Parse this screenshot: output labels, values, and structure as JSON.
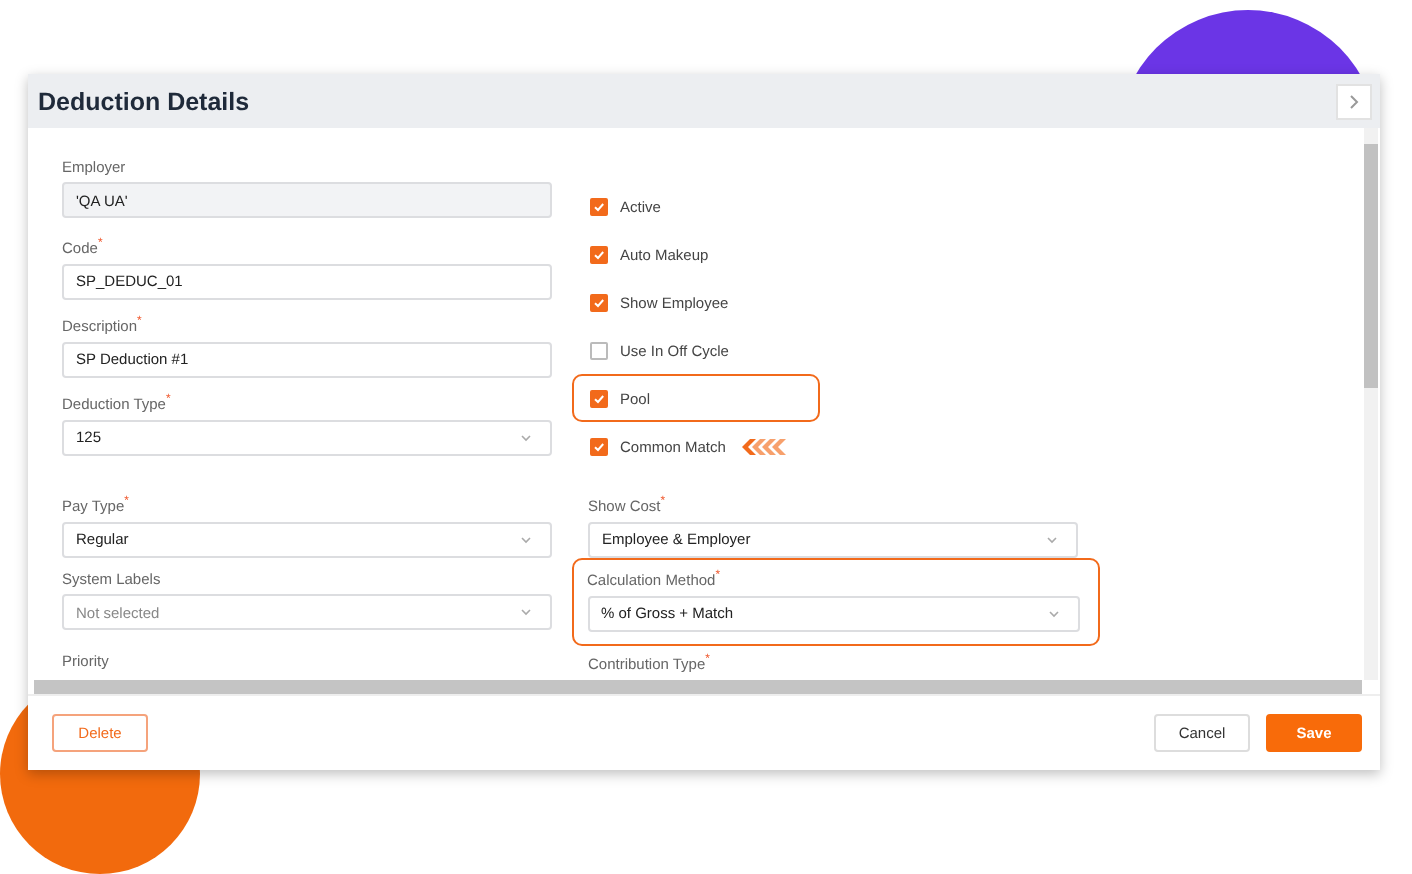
{
  "dialog": {
    "title": "Deduction Details"
  },
  "left_fields": [
    {
      "label": "Employer",
      "value": "'QA UA'",
      "kind": "text",
      "disabled": true
    },
    {
      "label": "Code$^{*}$",
      "value": "SP_DEDUC_01",
      "kind": "text",
      "disabled": false
    },
    {
      "label": "Description$^{*}$",
      "value": "SP Deduction #1",
      "kind": "text",
      "disabled": false
    },
    {
      "label": "Deduction Type$^{*}$",
      "value": "125",
      "kind": "select",
      "disabled": false
    }
  ],
  "checkboxes": [
    {
      "label": "Active",
      "checked": true,
      "highlighted": false,
      "pointer": false
    },
    {
      "label": "Auto Makeup",
      "checked": true,
      "highlighted": false,
      "pointer": false
    },
    {
      "label": "Show Employee",
      "checked": true,
      "highlighted": false,
      "pointer": false
    },
    {
      "label": "Use In Off Cycle",
      "checked": false,
      "highlighted": false,
      "pointer": false
    },
    {
      "label": "Pool",
      "checked": true,
      "highlighted": true,
      "pointer": false
    },
    {
      "label": "Common Match",
      "checked": true,
      "highlighted": false,
      "pointer": true
    }
  ],
  "lower_fields": [
    {
      "label": "Pay Type$^{*}$",
      "value": "Regular",
      "highlighted": false
    },
    {
      "label": "Show Cost$^{*}$",
      "value": "Employee & Employer",
      "highlighted": false
    },
    {
      "label": "System Labels",
      "placeholder": "Not selected",
      "highlighted": false
    },
    {
      "label": "Calculation Method$^{*}$",
      "value": "% of Gross + Match",
      "highlighted": true
    },
    {
      "label": "Priority",
      "highlighted": false
    },
    {
      "label": "Contribution Type$^{*}$",
      "highlighted": false
    }
  ],
  "buttons": [
    {
      "label": "Delete",
      "kind": "secondary"
    },
    {
      "label": "Cancel",
      "kind": "plain"
    },
    {
      "label": "Save",
      "kind": "primary"
    }
  ]
}
